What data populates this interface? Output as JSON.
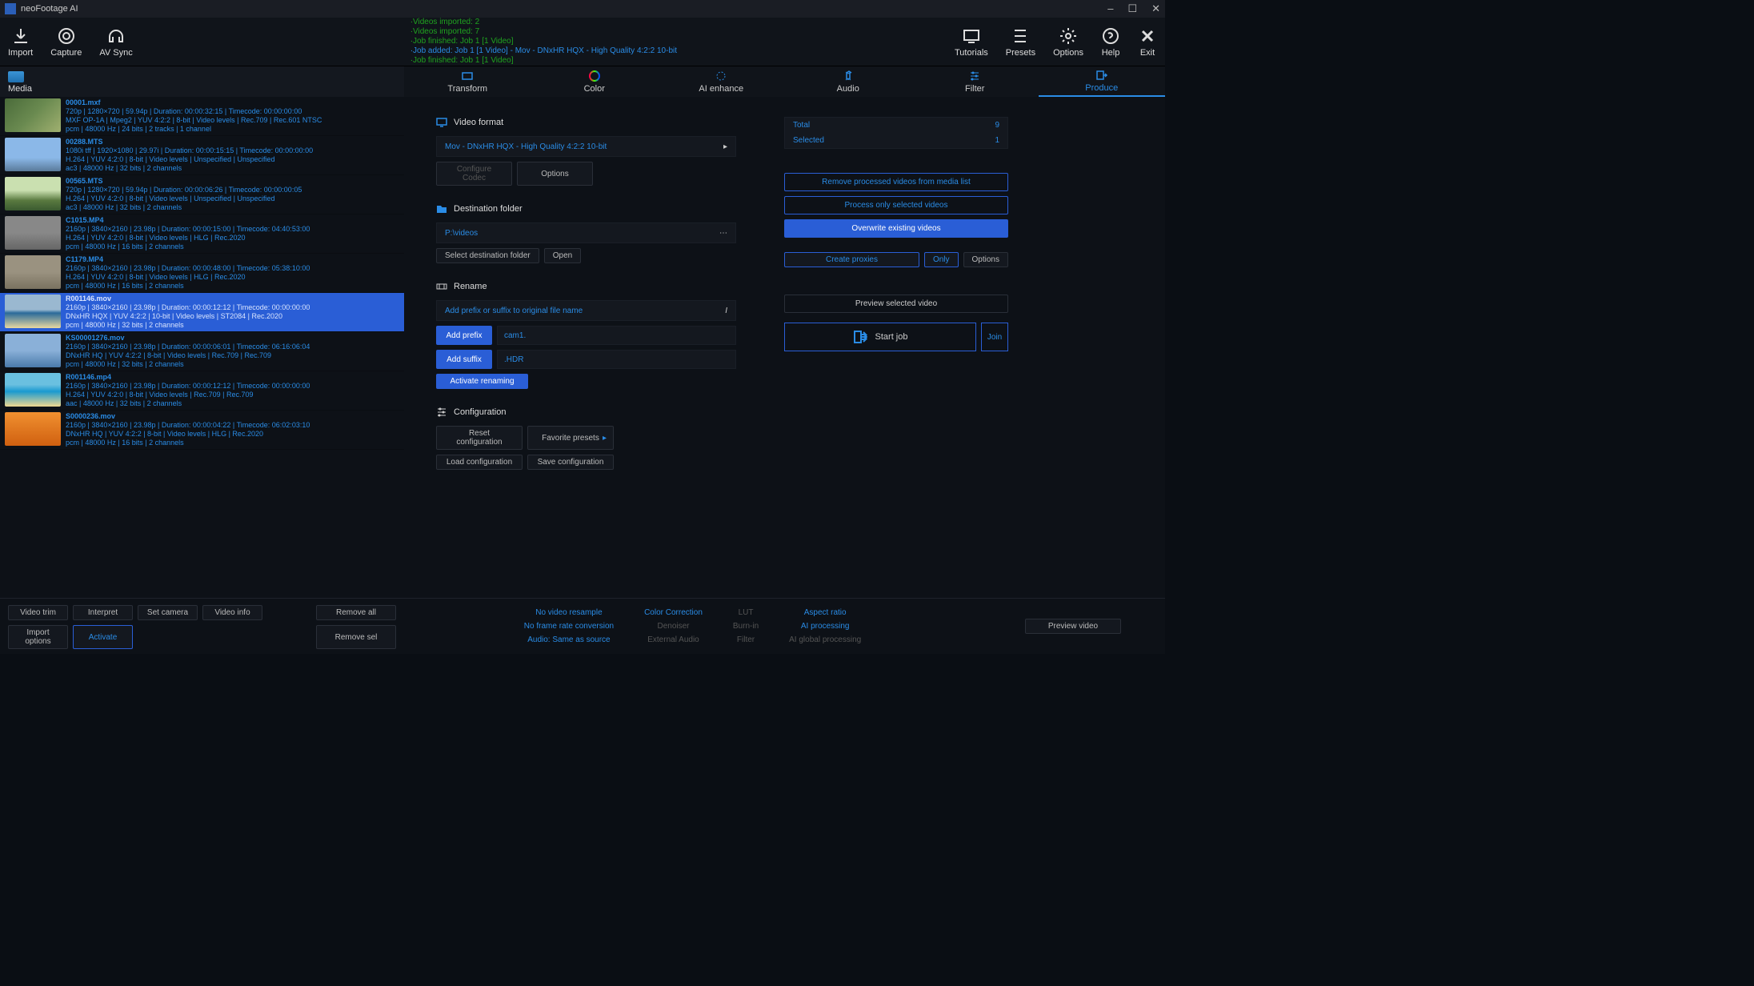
{
  "app": {
    "title": "neoFootage AI"
  },
  "winctl": {
    "min": "–",
    "max": "☐",
    "close": "✕"
  },
  "toolbar": {
    "left": [
      {
        "name": "import",
        "label": "Import"
      },
      {
        "name": "capture",
        "label": "Capture"
      },
      {
        "name": "avsync",
        "label": "AV Sync"
      }
    ],
    "log": [
      {
        "cls": "g",
        "text": "·Videos imported: 2"
      },
      {
        "cls": "g",
        "text": "·Videos imported: 7"
      },
      {
        "cls": "g",
        "text": "·Job finished: Job 1 [1 Video]"
      },
      {
        "cls": "b",
        "text": "·Job added: Job 1 [1 Video] -   Mov - DNxHR HQX - High Quality 4:2:2 10-bit"
      },
      {
        "cls": "g",
        "text": "·Job finished: Job 1 [1 Video]"
      }
    ],
    "right": [
      {
        "name": "tutorials",
        "label": "Tutorials"
      },
      {
        "name": "presets",
        "label": "Presets"
      },
      {
        "name": "options",
        "label": "Options"
      },
      {
        "name": "help",
        "label": "Help"
      },
      {
        "name": "exit",
        "label": "Exit"
      }
    ]
  },
  "tabs": {
    "media": "Media",
    "items": [
      {
        "id": "transform",
        "label": "Transform"
      },
      {
        "id": "color",
        "label": "Color"
      },
      {
        "id": "aienhance",
        "label": "AI enhance"
      },
      {
        "id": "audio",
        "label": "Audio"
      },
      {
        "id": "filter",
        "label": "Filter"
      },
      {
        "id": "produce",
        "label": "Produce",
        "active": true
      }
    ]
  },
  "clips": [
    {
      "name": "00001.mxf",
      "l1": "720p | 1280×720 | 59.94p | Duration:  00:00:32:15 | Timecode: 00:00:00:00",
      "l2": "MXF OP-1A | Mpeg2 | YUV 4:2:2 | 8-bit | Video levels | Rec.709 | Rec.601 NTSC",
      "l3": "pcm | 48000 Hz | 24 bits | 2 tracks | 1 channel",
      "thumb": "linear-gradient(135deg,#4a6b3a,#6a8a50,#a0b070)"
    },
    {
      "name": "00288.MTS",
      "l1": "1080i tff | 1920×1080 | 29.97i | Duration:  00:00:15:15 | Timecode: 00:00:00:00",
      "l2": "H.264 | YUV 4:2:0 | 8-bit | Video levels | Unspecified | Unspecified",
      "l3": "ac3 | 48000 Hz | 32 bits | 2 channels",
      "thumb": "linear-gradient(#8bb8e8 60%,#5a7a9a)"
    },
    {
      "name": "00565.MTS",
      "l1": "720p | 1280×720 | 59.94p | Duration:  00:00:06:26 | Timecode: 00:00:00:05",
      "l2": "H.264 | YUV 4:2:0 | 8-bit | Video levels | Unspecified | Unspecified",
      "l3": "ac3 | 48000 Hz | 32 bits | 2 channels",
      "thumb": "linear-gradient(#cae0b0 40%,#5a7a40 70%,#3a5a30)"
    },
    {
      "name": "C1015.MP4",
      "l1": "2160p | 3840×2160 | 23.98p | Duration:  00:00:15:00 | Timecode: 04:40:53:00",
      "l2": "H.264 | YUV 4:2:0 | 8-bit | Video levels | HLG | Rec.2020",
      "l3": "pcm | 48000 Hz | 16 bits | 2 channels",
      "thumb": "linear-gradient(#888 50%,#666)"
    },
    {
      "name": "C1179.MP4",
      "l1": "2160p | 3840×2160 | 23.98p | Duration:  00:00:48:00 | Timecode: 05:38:10:00",
      "l2": "H.264 | YUV 4:2:0 | 8-bit | Video levels | HLG | Rec.2020",
      "l3": "pcm | 48000 Hz | 16 bits | 2 channels",
      "thumb": "linear-gradient(#9a9280 50%,#7a7260)"
    },
    {
      "name": "R001146.mov",
      "sel": true,
      "l1": "2160p | 3840×2160 | 23.98p | Duration:  00:00:12:12 | Timecode: 00:00:00:00",
      "l2": "DNxHR HQX | YUV 4:2:2 | 10-bit | Video levels | ST2084 | Rec.2020",
      "l3": "pcm | 48000 Hz | 32 bits | 2 channels",
      "thumb": "linear-gradient(#9ab8d0 45%,#2a6a9a 55%,#e8d8a0)"
    },
    {
      "name": "KS00001276.mov",
      "l1": "2160p | 3840×2160 | 23.98p | Duration:  00:00:06:01 | Timecode: 06:16:06:04",
      "l2": "DNxHR HQ | YUV 4:2:2 | 8-bit | Video levels | Rec.709 | Rec.709",
      "l3": "pcm | 48000 Hz | 32 bits | 2 channels",
      "thumb": "linear-gradient(#8ab0d8 50%,#4a7aaa)"
    },
    {
      "name": "R001146.mp4",
      "l1": "2160p | 3840×2160 | 23.98p | Duration:  00:00:12:12 | Timecode: 00:00:00:00",
      "l2": "H.264 | YUV 4:2:0 | 8-bit | Video levels | Rec.709 | Rec.709",
      "l3": "aac | 48000 Hz | 32 bits | 2 channels",
      "thumb": "linear-gradient(#6ac0e0 35%,#1a9ad0 55%,#f0d890)"
    },
    {
      "name": "S0000236.mov",
      "l1": "2160p | 3840×2160 | 23.98p | Duration:  00:00:04:22 | Timecode: 06:02:03:10",
      "l2": "DNxHR HQ | YUV 4:2:2 | 8-bit | Video levels | HLG | Rec.2020",
      "l3": "pcm | 48000 Hz | 16 bits | 2 channels",
      "thumb": "linear-gradient(#f09030,#d06010)"
    }
  ],
  "produce": {
    "videoformat_hd": "Video format",
    "format": "Mov - DNxHR HQX - High Quality 4:2:2 10-bit",
    "configure_codec": "Configure Codec",
    "options": "Options",
    "dest_hd": "Destination folder",
    "dest": "P:\\videos",
    "select_dest": "Select destination folder",
    "open": "Open",
    "rename_hd": "Rename",
    "rename_ph": "Add prefix or suffix to original file name",
    "add_prefix": "Add prefix",
    "add_suffix": "Add suffix",
    "prefix_val": "cam1.",
    "suffix_val": ".HDR",
    "activate_ren": "Activate renaming",
    "config_hd": "Configuration",
    "reset_cfg": "Reset configuration",
    "fav_presets": "Favorite presets",
    "load_cfg": "Load configuration",
    "save_cfg": "Save configuration"
  },
  "side": {
    "total_lbl": "Total",
    "total": "9",
    "sel_lbl": "Selected",
    "sel": "1",
    "remove_proc": "Remove processed videos from media list",
    "proc_sel": "Process only selected videos",
    "overwrite": "Overwrite existing videos",
    "create_prox": "Create proxies",
    "only": "Only",
    "options": "Options",
    "prev_sel": "Preview selected video",
    "start": "Start  job",
    "join": "Join"
  },
  "footer": {
    "left": {
      "video_trim": "Video trim",
      "interpret": "Interpret",
      "set_camera": "Set camera",
      "video_info": "Video info",
      "remove_all": "Remove all",
      "import_opt": "Import options",
      "activate": "Activate",
      "remove_sel": "Remove sel"
    },
    "mid": {
      "r1": [
        "No video resample",
        "Color Correction",
        "LUT",
        "Aspect ratio"
      ],
      "r2": [
        "No frame rate conversion",
        "Denoiser",
        "Burn-in",
        "AI processing"
      ],
      "r3": [
        "Audio: Same as source",
        "External Audio",
        "Filter",
        "AI global processing"
      ],
      "cls": {
        "r1": [
          "b",
          "b",
          "g",
          "b"
        ],
        "r2": [
          "b",
          "g",
          "g",
          "b"
        ],
        "r3": [
          "b",
          "g",
          "g",
          "g"
        ]
      }
    },
    "right": "Preview video"
  }
}
